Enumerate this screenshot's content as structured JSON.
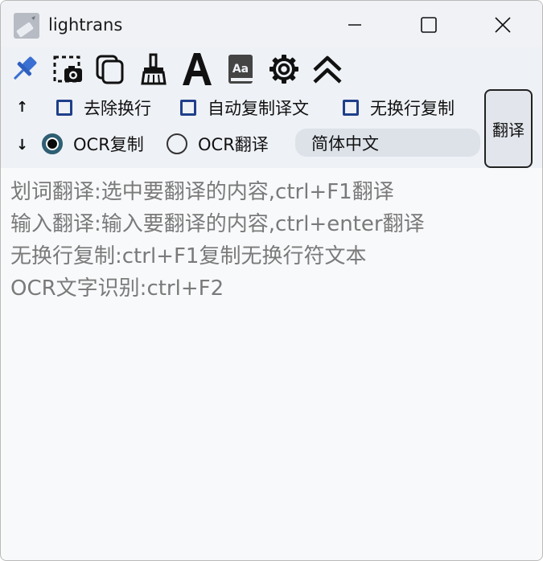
{
  "window": {
    "title": "lightrans",
    "controls": [
      "minimize-icon",
      "maximize-icon",
      "close-icon"
    ]
  },
  "toolbar": {
    "icons": [
      "pin-icon",
      "screenshot-camera-icon",
      "copy-icon",
      "broom-icon",
      "font-a-icon",
      "dictionary-icon",
      "gear-icon",
      "double-chevron-up-icon"
    ],
    "accent": "#3b6fd1"
  },
  "options": {
    "up_arrow": "↑",
    "down_arrow": "↓",
    "checkboxes": [
      {
        "label": "去除换行",
        "checked": false
      },
      {
        "label": "自动复制译文",
        "checked": false
      },
      {
        "label": "无换行复制",
        "checked": false
      }
    ],
    "radios": [
      {
        "label": "OCR复制",
        "selected": true
      },
      {
        "label": "OCR翻译",
        "selected": false
      }
    ],
    "language": "简体中文",
    "translate_button": "翻译"
  },
  "content": {
    "lines": [
      "划词翻译:选中要翻译的内容,ctrl+F1翻译",
      "输入翻译:输入要翻译的内容,ctrl+enter翻译",
      "无换行复制:ctrl+F1复制无换行符文本",
      "OCR文字识别:ctrl+F2"
    ],
    "text_color": "#7a7a7a"
  }
}
